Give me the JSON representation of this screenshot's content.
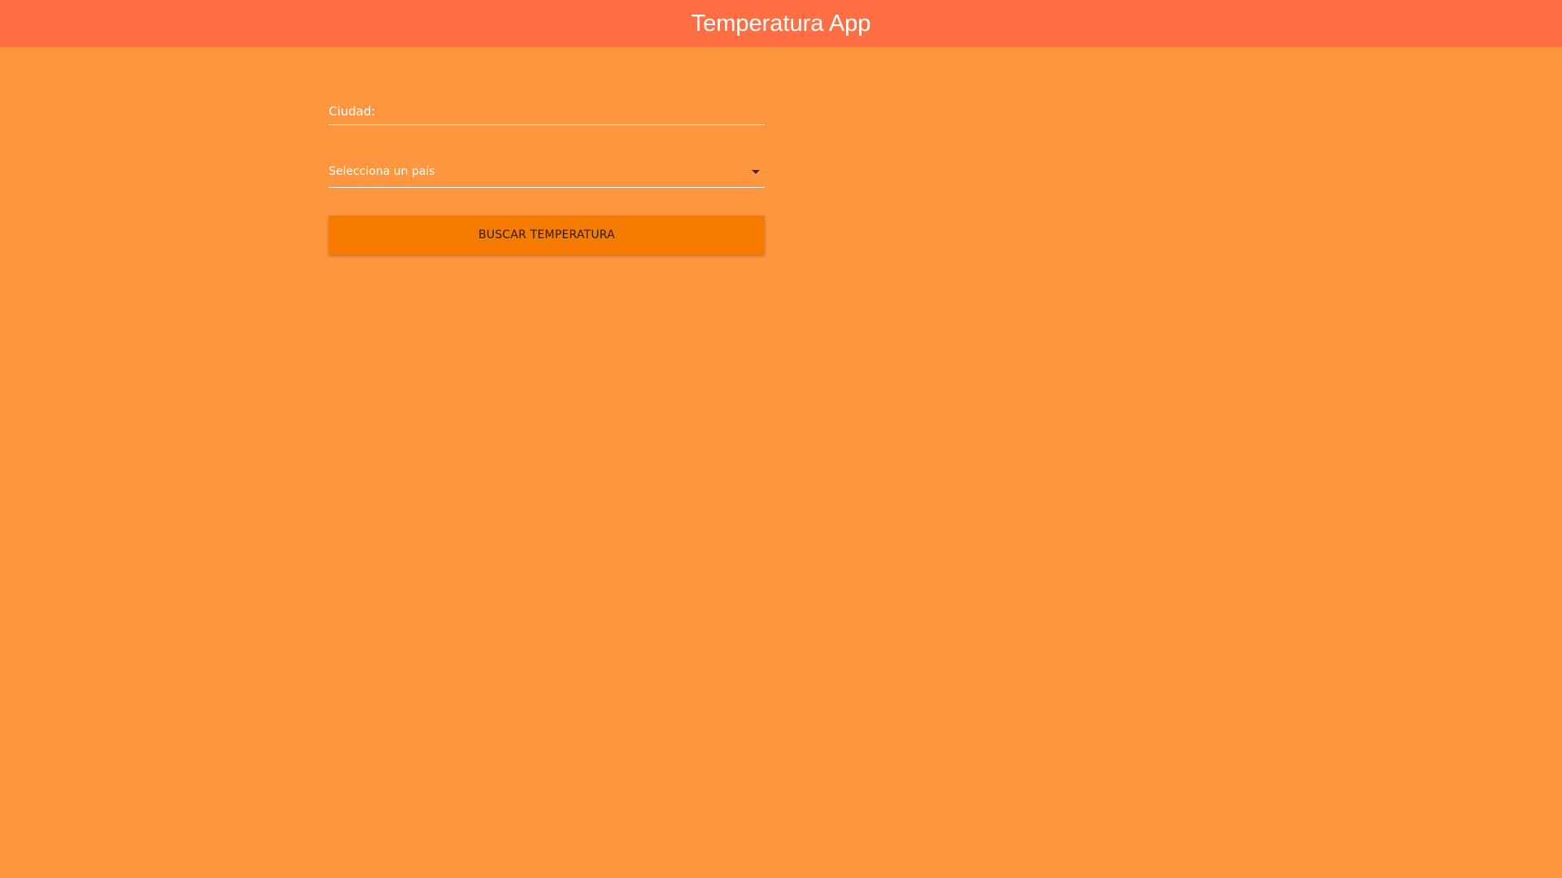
{
  "header": {
    "title": "Temperatura App"
  },
  "form": {
    "city": {
      "placeholder": "Ciudad:",
      "value": ""
    },
    "country": {
      "selected": "Selecciona un país",
      "icon": "chevron-down-icon"
    },
    "search_button_label": "BUSCAR TEMPERATURA"
  },
  "colors": {
    "background": "#FD963F",
    "header": "#FF6F43",
    "button": "#F57C00",
    "text_light": "#FFFFFF"
  }
}
